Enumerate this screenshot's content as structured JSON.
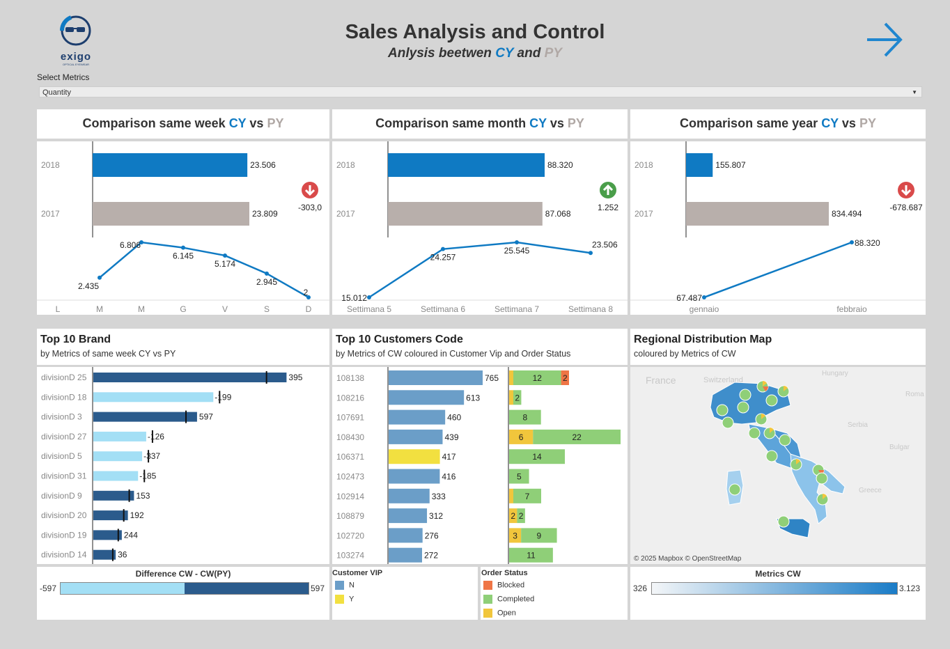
{
  "header": {
    "logo_text": "exigo",
    "logo_tagline": "OPTICAL EYEWEAR",
    "title": "Sales Analysis and Control",
    "subtitle_prefix": "Anlysis beetwen",
    "subtitle_cy": "CY",
    "subtitle_and": "and",
    "subtitle_py": "PY",
    "next_icon": "arrow-right-icon"
  },
  "filter": {
    "label": "Select Metrics",
    "value": "Quantity"
  },
  "colors": {
    "cy": "#0f7ac3",
    "py": "#b8afab",
    "dark_blue": "#2b5b8c",
    "light_blue": "#a3dff5",
    "customer_n": "#6b9ec8",
    "customer_y": "#f2e040",
    "blocked": "#ef7545",
    "completed": "#8fcf78",
    "open": "#f1c63c",
    "up": "#4a9e4a",
    "down": "#d94a4a"
  },
  "comparisons": [
    {
      "title_prefix": "Comparison same",
      "period": "week",
      "cy": "CY",
      "vs": "vs",
      "py": "PY",
      "bars": [
        {
          "year": "2018",
          "value": 23506,
          "label": "23.506"
        },
        {
          "year": "2017",
          "value": 23809,
          "label": "23.809"
        }
      ],
      "delta": "-303,0",
      "trend": "down",
      "line": {
        "x": [
          "L",
          "M",
          "M",
          "G",
          "V",
          "S",
          "D"
        ],
        "values": [
          null,
          2435,
          6806,
          6145,
          5174,
          2945,
          2
        ],
        "labels": [
          "",
          "2.435",
          "6.806",
          "6.145",
          "5.174",
          "2.945",
          "2"
        ]
      }
    },
    {
      "title_prefix": "Comparison same",
      "period": "month",
      "cy": "CY",
      "vs": "vs",
      "py": "PY",
      "bars": [
        {
          "year": "2018",
          "value": 88320,
          "label": "88.320"
        },
        {
          "year": "2017",
          "value": 87068,
          "label": "87.068"
        }
      ],
      "delta": "1.252",
      "trend": "up",
      "line": {
        "x": [
          "Settimana 5",
          "Settimana 6",
          "Settimana 7",
          "Settimana 8"
        ],
        "values": [
          15012,
          24257,
          25545,
          23506
        ],
        "labels": [
          "15.012",
          "24.257",
          "25.545",
          "23.506"
        ]
      }
    },
    {
      "title_prefix": "Comparison same",
      "period": "year",
      "cy": "CY",
      "vs": "vs",
      "py": "PY",
      "bars": [
        {
          "year": "2018",
          "value": 155807,
          "label": "155.807"
        },
        {
          "year": "2017",
          "value": 834494,
          "label": "834.494"
        }
      ],
      "delta": "-678.687",
      "trend": "down",
      "line": {
        "x": [
          "gennaio",
          "febbraio"
        ],
        "values": [
          67487,
          88320
        ],
        "labels": [
          "67.487",
          "88.320"
        ]
      }
    }
  ],
  "brand": {
    "title": "Top 10 Brand",
    "subtitle": "by Metrics of same week CY vs PY",
    "rows": [
      {
        "name": "divisionD 25",
        "value": 395,
        "label": "395",
        "ref": 0.9,
        "pos": true,
        "len": 0.95
      },
      {
        "name": "divisionD 18",
        "value": -199,
        "label": "-199",
        "ref": 0.68,
        "pos": false,
        "len": 0.59
      },
      {
        "name": "divisionD 3",
        "value": 597,
        "label": "597",
        "ref": 0.45,
        "pos": true,
        "len": 0.51
      },
      {
        "name": "divisionD 27",
        "value": -126,
        "label": "-126",
        "ref": 0.3,
        "pos": false,
        "len": 0.26
      },
      {
        "name": "divisionD 5",
        "value": -337,
        "label": "-337",
        "ref": 0.3,
        "pos": false,
        "len": 0.24
      },
      {
        "name": "divisionD 31",
        "value": -185,
        "label": "-185",
        "ref": 0.25,
        "pos": false,
        "len": 0.22
      },
      {
        "name": "divisionD 9",
        "value": 153,
        "label": "153",
        "ref": 0.18,
        "pos": true,
        "len": 0.2
      },
      {
        "name": "divisionD 20",
        "value": 192,
        "label": "192",
        "ref": 0.14,
        "pos": true,
        "len": 0.17
      },
      {
        "name": "divisionD 19",
        "value": 244,
        "label": "244",
        "ref": 0.1,
        "pos": true,
        "len": 0.14
      },
      {
        "name": "divisionD 14",
        "value": 36,
        "label": "36",
        "ref": 0.1,
        "pos": true,
        "len": 0.11
      }
    ]
  },
  "customers": {
    "title": "Top 10 Customers Code",
    "subtitle": "by Metrics of CW coloured in Customer Vip and Order Status",
    "rows": [
      {
        "code": "108138",
        "value": 765,
        "vip": "N",
        "status": [
          {
            "s": "open",
            "v": 1
          },
          {
            "s": "completed",
            "v": 12
          },
          {
            "s": "blocked",
            "v": 2
          }
        ]
      },
      {
        "code": "108216",
        "value": 613,
        "vip": "N",
        "status": [
          {
            "s": "open",
            "v": 1
          },
          {
            "s": "completed",
            "v": 2
          }
        ]
      },
      {
        "code": "107691",
        "value": 460,
        "vip": "N",
        "status": [
          {
            "s": "completed",
            "v": 8
          }
        ]
      },
      {
        "code": "108430",
        "value": 439,
        "vip": "N",
        "status": [
          {
            "s": "open",
            "v": 6
          },
          {
            "s": "completed",
            "v": 22
          }
        ]
      },
      {
        "code": "106371",
        "value": 417,
        "vip": "Y",
        "status": [
          {
            "s": "completed",
            "v": 14
          }
        ]
      },
      {
        "code": "102473",
        "value": 416,
        "vip": "N",
        "status": [
          {
            "s": "completed",
            "v": 5
          }
        ]
      },
      {
        "code": "102914",
        "value": 333,
        "vip": "N",
        "status": [
          {
            "s": "open",
            "v": 1
          },
          {
            "s": "completed",
            "v": 7
          }
        ]
      },
      {
        "code": "108879",
        "value": 312,
        "vip": "N",
        "status": [
          {
            "s": "open",
            "v": 2
          },
          {
            "s": "completed",
            "v": 2
          }
        ]
      },
      {
        "code": "102720",
        "value": 276,
        "vip": "N",
        "status": [
          {
            "s": "open",
            "v": 3
          },
          {
            "s": "completed",
            "v": 9
          }
        ]
      },
      {
        "code": "103274",
        "value": 272,
        "vip": "N",
        "status": [
          {
            "s": "completed",
            "v": 11
          }
        ]
      }
    ]
  },
  "map": {
    "title": "Regional Distribution Map",
    "subtitle": "coloured by Metrics of CW",
    "attribution": "© 2025 Mapbox © OpenStreetMap",
    "places": [
      "France",
      "Switzerland",
      "Hungary",
      "Roma",
      "Serbia",
      "Bulgar",
      "Greece"
    ]
  },
  "legends": {
    "difference": {
      "title": "Difference CW - CW(PY)",
      "min": "-597",
      "max": "597"
    },
    "vip": {
      "title": "Customer VIP",
      "items": [
        {
          "label": "N",
          "color": "#6b9ec8"
        },
        {
          "label": "Y",
          "color": "#f2e040"
        }
      ]
    },
    "order": {
      "title": "Order Status",
      "items": [
        {
          "label": "Blocked",
          "color": "#ef7545"
        },
        {
          "label": "Completed",
          "color": "#8fcf78"
        },
        {
          "label": "Open",
          "color": "#f1c63c"
        }
      ]
    },
    "metrics": {
      "title": "Metrics CW",
      "min": "326",
      "max": "3.123"
    }
  }
}
